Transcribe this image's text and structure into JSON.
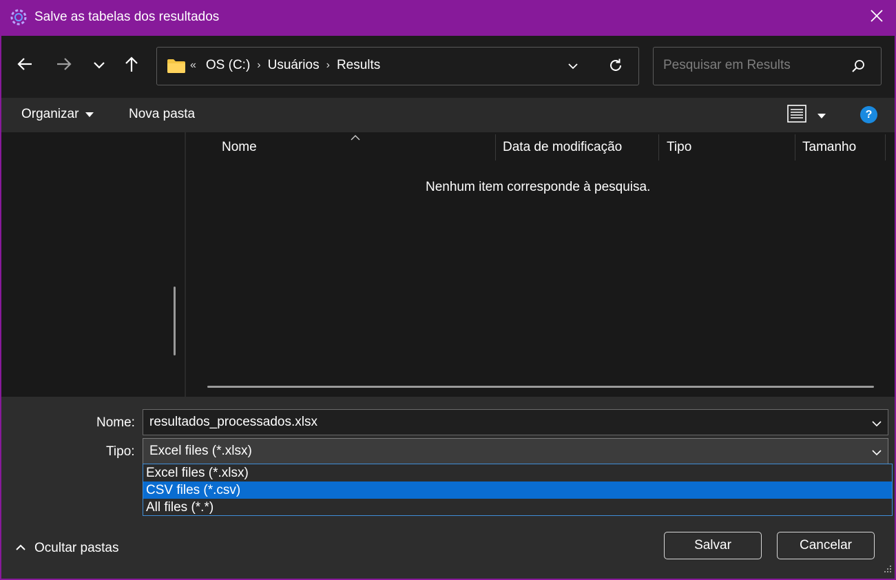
{
  "window": {
    "title": "Salve as tabelas dos resultados",
    "icons": {
      "app": "app-logo-icon",
      "close": "close-icon"
    }
  },
  "nav": {
    "icons": [
      "back-arrow-icon",
      "forward-arrow-icon",
      "recent-locations-chevron-icon",
      "up-arrow-icon"
    ]
  },
  "address": {
    "overflow": "«",
    "crumbs": [
      "OS (C:)",
      "Usuários",
      "Results"
    ],
    "separator": "›",
    "icons": [
      "folder-icon",
      "chevron-down-icon",
      "refresh-icon"
    ]
  },
  "search": {
    "placeholder": "Pesquisar em Results",
    "value": "",
    "icon": "search-icon"
  },
  "toolbar": {
    "organize_label": "Organizar",
    "new_folder_label": "Nova pasta",
    "help_label": "?",
    "icons": [
      "caret-down-icon",
      "view-details-icon",
      "help-icon"
    ]
  },
  "file_list": {
    "columns": [
      "Nome",
      "Data de modificação",
      "Tipo",
      "Tamanho"
    ],
    "sorted_by": "Nome",
    "empty_message": "Nenhum item corresponde à pesquisa."
  },
  "form": {
    "name_label": "Nome:",
    "name_value": "resultados_processados.xlsx",
    "type_label": "Tipo:",
    "type_value": "Excel files (*.xlsx)",
    "type_options": [
      "Excel files (*.xlsx)",
      "CSV files (*.csv)",
      "All files (*.*)"
    ],
    "type_highlighted": "CSV files (*.csv)"
  },
  "footer": {
    "hide_folders_label": "Ocultar pastas",
    "save_label": "Salvar",
    "cancel_label": "Cancelar"
  },
  "colors": {
    "title_bar": "#871a9a",
    "highlight": "#0a6dd1",
    "help_icon": "#1a8ae0",
    "folder": "#f4c543"
  }
}
